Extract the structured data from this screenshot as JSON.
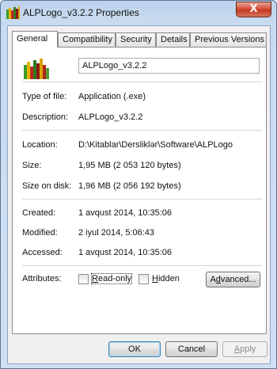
{
  "window": {
    "title": "ALPLogo_v3.2.2 Properties",
    "close_glyph": "X"
  },
  "tabs": [
    "General",
    "Compatibility",
    "Security",
    "Details",
    "Previous Versions"
  ],
  "file": {
    "name": "ALPLogo_v3.2.2"
  },
  "labels": {
    "type": "Type of file:",
    "description": "Description:",
    "location": "Location:",
    "size": "Size:",
    "size_on_disk": "Size on disk:",
    "created": "Created:",
    "modified": "Modified:",
    "accessed": "Accessed:",
    "attributes": "Attributes:"
  },
  "values": {
    "type": "Application (.exe)",
    "description": "ALPLogo_v3.2.2",
    "location": "D:\\Kitablar\\Dersliklər\\Software\\ALPLogo",
    "size": "1,95 MB (2 053 120 bytes)",
    "size_on_disk": "1,96 MB (2 056 192 bytes)",
    "created": "1 avqust 2014, 10:35:06",
    "modified": "2 iyul 2014, 5:06:43",
    "accessed": "1 avqust 2014, 10:35:06"
  },
  "attributes": {
    "readonly": {
      "mnemonic": "R",
      "rest": "ead-only",
      "checked": false
    },
    "hidden": {
      "mnemonic": "H",
      "rest": "idden",
      "checked": false
    },
    "advanced": {
      "pre": "A",
      "mnemonic": "d",
      "rest": "vanced..."
    }
  },
  "buttons": {
    "ok": "OK",
    "cancel": "Cancel",
    "apply": {
      "mnemonic": "A",
      "rest": "pply"
    }
  },
  "icons": {
    "app": "alplogo-app-icon",
    "close": "close-icon"
  }
}
